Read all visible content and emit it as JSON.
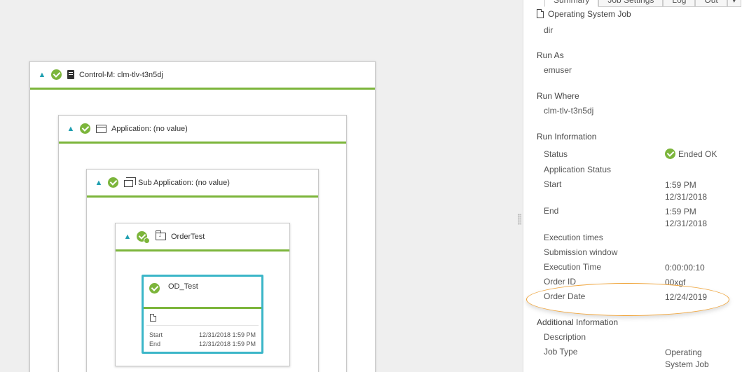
{
  "canvas": {
    "control_m": {
      "title": "Control-M: clm-tlv-t3n5dj"
    },
    "application": {
      "title": "Application: (no value)"
    },
    "sub_application": {
      "title": "Sub Application: (no value)"
    },
    "folder": {
      "title": "OrderTest"
    },
    "job": {
      "name": "OD_Test",
      "start_label": "Start",
      "start_value": "12/31/2018 1:59 PM",
      "end_label": "End",
      "end_value": "12/31/2018 1:59 PM"
    }
  },
  "panel": {
    "tabs": [
      "Summary",
      "Job Settings",
      "Log",
      "Out"
    ],
    "job_kind": "Operating System Job",
    "command": "dir",
    "run_as": {
      "label": "Run As",
      "value": "emuser"
    },
    "run_where": {
      "label": "Run Where",
      "value": "clm-tlv-t3n5dj"
    },
    "run_information": {
      "label": "Run Information",
      "status_label": "Status",
      "status_value": "Ended OK",
      "application_status_label": "Application Status",
      "start_label": "Start",
      "start_time": "1:59 PM",
      "start_date": "12/31/2018",
      "end_label": "End",
      "end_time": "1:59 PM",
      "end_date": "12/31/2018",
      "execution_times_label": "Execution times",
      "submission_window_label": "Submission window",
      "execution_time_label": "Execution Time",
      "execution_time_value": "0:00:00:10",
      "order_id_label": "Order ID",
      "order_id_value": "00xgf",
      "order_date_label": "Order Date",
      "order_date_value": "12/24/2019"
    },
    "additional_information": {
      "label": "Additional Information",
      "description_label": "Description",
      "job_type_label": "Job Type",
      "job_type_line1": "Operating",
      "job_type_line2": "System Job"
    }
  },
  "colors": {
    "status_green": "#7cb53b",
    "selection_teal": "#3bb6c8",
    "highlight_orange": "#f0a53c"
  }
}
